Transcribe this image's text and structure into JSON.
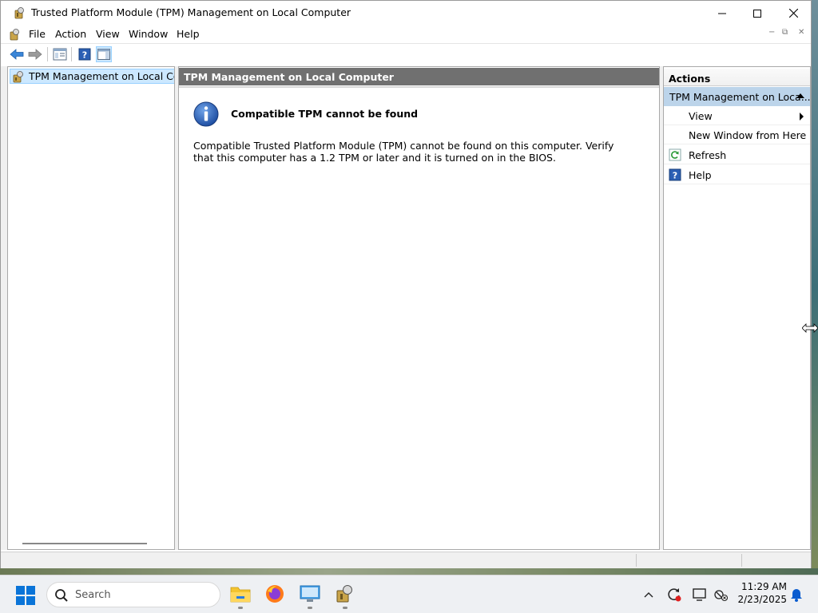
{
  "window": {
    "title": "Trusted Platform Module (TPM) Management on Local Computer"
  },
  "menu": [
    "File",
    "Action",
    "View",
    "Window",
    "Help"
  ],
  "tree": {
    "root_label": "TPM Management on Local Comp"
  },
  "content": {
    "header": "TPM Management on Local Computer",
    "message_title": "Compatible TPM cannot be found",
    "message_body": "Compatible Trusted Platform Module (TPM) cannot be found on this computer. Verify that this computer has a 1.2 TPM or later and it is turned on in the BIOS."
  },
  "actions": {
    "header": "Actions",
    "group_label": "TPM Management on Loca...",
    "items": [
      {
        "label": "View",
        "icon": "none",
        "has_submenu": true
      },
      {
        "label": "New Window from Here",
        "icon": "none",
        "has_submenu": false
      },
      {
        "label": "Refresh",
        "icon": "refresh-icon",
        "has_submenu": false
      },
      {
        "label": "Help",
        "icon": "help-icon",
        "has_submenu": false
      }
    ]
  },
  "taskbar": {
    "search_placeholder": "Search",
    "apps": [
      "file-explorer-icon",
      "firefox-icon",
      "remote-desktop-icon",
      "tpm-management-icon"
    ],
    "tray": [
      "show-hidden-icons-chevron",
      "update-sync-icon",
      "display-icon",
      "network-disconnected-icon"
    ],
    "time": "11:29 AM",
    "date": "2/23/2025"
  },
  "colors": {
    "content_header_bg": "#707070",
    "actions_group_bg": "#bcd4ea",
    "tree_selected_bg": "#cce8ff",
    "taskbar_bg": "#eef0f3"
  }
}
